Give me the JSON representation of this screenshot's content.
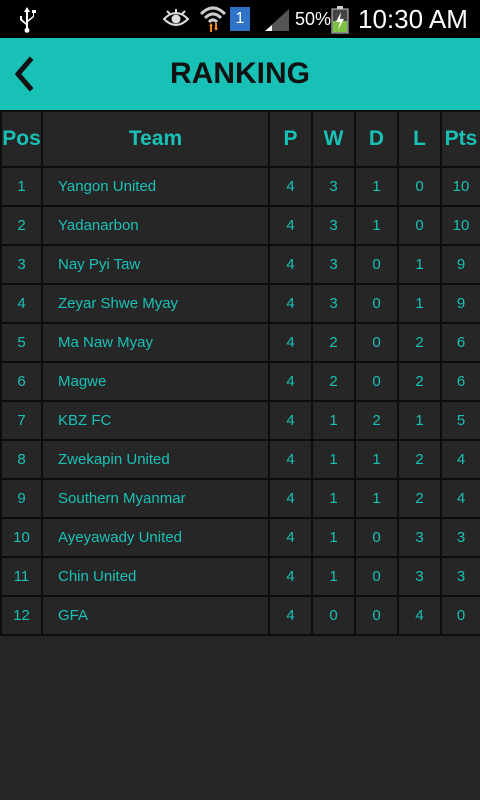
{
  "status_bar": {
    "sim_slot": "1",
    "battery_percent": "50%",
    "time": "10:30 AM",
    "icons": [
      "usb-icon",
      "eye-icon",
      "wifi-icon",
      "sim-icon",
      "signal-icon",
      "battery-icon"
    ]
  },
  "app_bar": {
    "title": "RANKING",
    "back_icon": "chevron-left-icon",
    "background": "#18c1b6"
  },
  "table": {
    "headers": [
      "Pos",
      "Team",
      "P",
      "W",
      "D",
      "L",
      "Pts"
    ],
    "rows": [
      {
        "pos": "1",
        "team": "Yangon United",
        "p": "4",
        "w": "3",
        "d": "1",
        "l": "0",
        "pts": "10"
      },
      {
        "pos": "2",
        "team": "Yadanarbon",
        "p": "4",
        "w": "3",
        "d": "1",
        "l": "0",
        "pts": "10"
      },
      {
        "pos": "3",
        "team": "Nay Pyi Taw",
        "p": "4",
        "w": "3",
        "d": "0",
        "l": "1",
        "pts": "9"
      },
      {
        "pos": "4",
        "team": "Zeyar Shwe Myay",
        "p": "4",
        "w": "3",
        "d": "0",
        "l": "1",
        "pts": "9"
      },
      {
        "pos": "5",
        "team": "Ma Naw Myay",
        "p": "4",
        "w": "2",
        "d": "0",
        "l": "2",
        "pts": "6"
      },
      {
        "pos": "6",
        "team": "Magwe",
        "p": "4",
        "w": "2",
        "d": "0",
        "l": "2",
        "pts": "6"
      },
      {
        "pos": "7",
        "team": "KBZ FC",
        "p": "4",
        "w": "1",
        "d": "2",
        "l": "1",
        "pts": "5"
      },
      {
        "pos": "8",
        "team": "Zwekapin United",
        "p": "4",
        "w": "1",
        "d": "1",
        "l": "2",
        "pts": "4"
      },
      {
        "pos": "9",
        "team": "Southern Myanmar",
        "p": "4",
        "w": "1",
        "d": "1",
        "l": "2",
        "pts": "4"
      },
      {
        "pos": "10",
        "team": "Ayeyawady United",
        "p": "4",
        "w": "1",
        "d": "0",
        "l": "3",
        "pts": "3"
      },
      {
        "pos": "11",
        "team": "Chin United",
        "p": "4",
        "w": "1",
        "d": "0",
        "l": "3",
        "pts": "3"
      },
      {
        "pos": "12",
        "team": "GFA",
        "p": "4",
        "w": "0",
        "d": "0",
        "l": "4",
        "pts": "0"
      }
    ],
    "accent_color": "#18c1b6",
    "background": "#262626"
  }
}
